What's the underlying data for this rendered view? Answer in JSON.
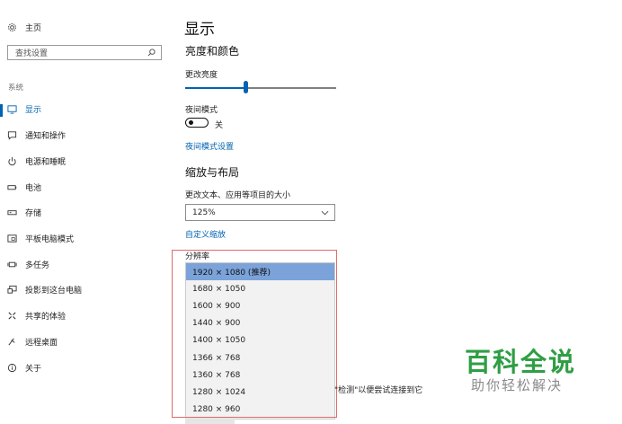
{
  "sidebar": {
    "home_label": "主页",
    "search_placeholder": "查找设置",
    "section_label": "系统",
    "items": [
      {
        "label": "显示",
        "icon": "monitor-icon"
      },
      {
        "label": "通知和操作",
        "icon": "notification-icon"
      },
      {
        "label": "电源和睡眠",
        "icon": "power-icon"
      },
      {
        "label": "电池",
        "icon": "battery-icon"
      },
      {
        "label": "存储",
        "icon": "storage-icon"
      },
      {
        "label": "平板电脑模式",
        "icon": "tablet-mode-icon"
      },
      {
        "label": "多任务",
        "icon": "multitasking-icon"
      },
      {
        "label": "投影到这台电脑",
        "icon": "projecting-icon"
      },
      {
        "label": "共享的体验",
        "icon": "shared-experiences-icon"
      },
      {
        "label": "远程桌面",
        "icon": "remote-desktop-icon"
      },
      {
        "label": "关于",
        "icon": "info-icon"
      }
    ],
    "active_index": 0
  },
  "main": {
    "title": "显示",
    "brightness": {
      "heading": "亮度和颜色",
      "label": "更改亮度",
      "level_percent": 40
    },
    "night_light": {
      "label": "夜间模式",
      "state_text": "关",
      "settings_link": "夜间模式设置"
    },
    "scale": {
      "heading": "缩放与布局",
      "label": "更改文本、应用等项目的大小",
      "value": "125%",
      "custom_link": "自定义缩放"
    },
    "resolution": {
      "label": "分辨率",
      "options": [
        "1920 × 1080 (推荐)",
        "1680 × 1050",
        "1600 × 900",
        "1440 × 900",
        "1400 × 1050",
        "1366 × 768",
        "1360 × 768",
        "1280 × 1024",
        "1280 × 960"
      ],
      "selected_index": 0
    },
    "detect_text_fragment": "\"检测\"以便尝试连接到它"
  },
  "watermark": {
    "title": "百科全说",
    "subtitle": "助你轻松解决"
  },
  "colors": {
    "accent": "#0063b1",
    "highlight": "#7ba3d9",
    "annotation_box": "#e06a6a",
    "watermark_green": "#2f9e44"
  }
}
